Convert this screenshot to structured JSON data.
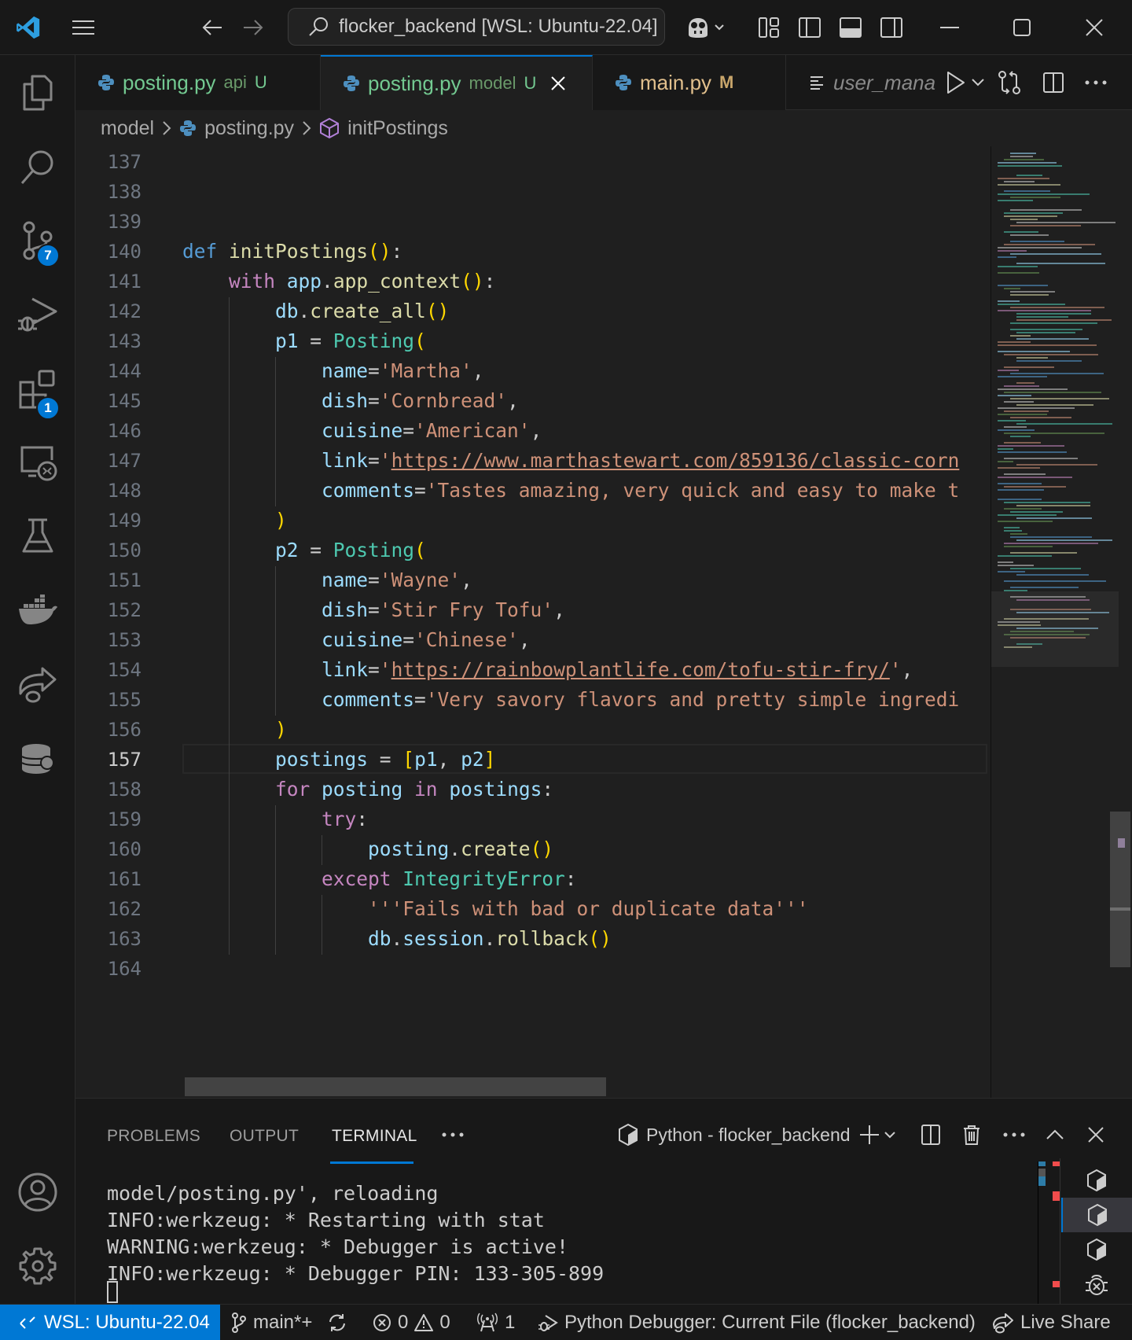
{
  "titlebar": {
    "command_center": "flocker_backend [WSL: Ubuntu-22.04]"
  },
  "activitybar": {
    "items": [
      {
        "name": "explorer",
        "icon": "files-icon"
      },
      {
        "name": "search",
        "icon": "search-icon"
      },
      {
        "name": "source-control",
        "icon": "source-control-icon",
        "badge": "7"
      },
      {
        "name": "run-debug",
        "icon": "run-debug-icon"
      },
      {
        "name": "extensions",
        "icon": "extensions-icon",
        "badge": "1"
      },
      {
        "name": "remote-explorer",
        "icon": "remote-explorer-icon"
      },
      {
        "name": "testing",
        "icon": "flask-icon"
      },
      {
        "name": "docker",
        "icon": "docker-icon"
      },
      {
        "name": "live-share",
        "icon": "live-share-icon"
      },
      {
        "name": "sqlalchemy",
        "icon": "sqla-icon"
      }
    ],
    "bottom": [
      {
        "name": "accounts",
        "icon": "account-icon"
      },
      {
        "name": "manage",
        "icon": "gear-icon"
      }
    ]
  },
  "tabs": [
    {
      "label": "posting.py",
      "desc": "api",
      "status": "U",
      "color": "#73c991",
      "active": false
    },
    {
      "label": "posting.py",
      "desc": "model",
      "status": "U",
      "color": "#73c991",
      "active": true
    },
    {
      "label": "main.py",
      "desc": "",
      "status": "M",
      "color": "#e2c08d",
      "active": false
    }
  ],
  "tab_actions": {
    "outline_label": "user_mana"
  },
  "breadcrumb": [
    "model",
    "posting.py",
    "initPostings"
  ],
  "editor": {
    "current_line": 157,
    "lines": [
      {
        "n": "137",
        "tokens": []
      },
      {
        "n": "138",
        "tokens": []
      },
      {
        "n": "139",
        "tokens": []
      },
      {
        "n": "140",
        "tokens": [
          [
            "kw",
            "def "
          ],
          [
            "fn",
            "initPostings"
          ],
          [
            "br",
            "()"
          ],
          [
            "",
            ":"
          ]
        ]
      },
      {
        "n": "141",
        "tokens": [
          [
            "",
            "    "
          ],
          [
            "ctl",
            "with "
          ],
          [
            "var",
            "app"
          ],
          [
            "",
            "."
          ],
          [
            "fn",
            "app_context"
          ],
          [
            "br",
            "()"
          ],
          [
            "",
            ":"
          ]
        ]
      },
      {
        "n": "142",
        "tokens": [
          [
            "",
            "        "
          ],
          [
            "var",
            "db"
          ],
          [
            "",
            "."
          ],
          [
            "fn",
            "create_all"
          ],
          [
            "br",
            "()"
          ]
        ]
      },
      {
        "n": "143",
        "tokens": [
          [
            "",
            "        "
          ],
          [
            "var",
            "p1"
          ],
          [
            "",
            " = "
          ],
          [
            "cls",
            "Posting"
          ],
          [
            "br",
            "("
          ]
        ]
      },
      {
        "n": "144",
        "tokens": [
          [
            "",
            "            "
          ],
          [
            "var",
            "name"
          ],
          [
            "",
            "="
          ],
          [
            "str",
            "'Martha'"
          ],
          [
            "",
            ","
          ]
        ]
      },
      {
        "n": "145",
        "tokens": [
          [
            "",
            "            "
          ],
          [
            "var",
            "dish"
          ],
          [
            "",
            "="
          ],
          [
            "str",
            "'Cornbread'"
          ],
          [
            "",
            ","
          ]
        ]
      },
      {
        "n": "146",
        "tokens": [
          [
            "",
            "            "
          ],
          [
            "var",
            "cuisine"
          ],
          [
            "",
            "="
          ],
          [
            "str",
            "'American'"
          ],
          [
            "",
            ","
          ]
        ]
      },
      {
        "n": "147",
        "tokens": [
          [
            "",
            "            "
          ],
          [
            "var",
            "link"
          ],
          [
            "",
            "="
          ],
          [
            "str",
            "'"
          ],
          [
            "url",
            "https://www.marthastewart.com/859136/classic-corn"
          ]
        ]
      },
      {
        "n": "148",
        "tokens": [
          [
            "",
            "            "
          ],
          [
            "var",
            "comments"
          ],
          [
            "",
            "="
          ],
          [
            "str",
            "'Tastes amazing, very quick and easy to make t"
          ]
        ]
      },
      {
        "n": "149",
        "tokens": [
          [
            "",
            "        "
          ],
          [
            "br",
            ")"
          ]
        ]
      },
      {
        "n": "150",
        "tokens": [
          [
            "",
            "        "
          ],
          [
            "var",
            "p2"
          ],
          [
            "",
            " = "
          ],
          [
            "cls",
            "Posting"
          ],
          [
            "br",
            "("
          ]
        ]
      },
      {
        "n": "151",
        "tokens": [
          [
            "",
            "            "
          ],
          [
            "var",
            "name"
          ],
          [
            "",
            "="
          ],
          [
            "str",
            "'Wayne'"
          ],
          [
            "",
            ","
          ]
        ]
      },
      {
        "n": "152",
        "tokens": [
          [
            "",
            "            "
          ],
          [
            "var",
            "dish"
          ],
          [
            "",
            "="
          ],
          [
            "str",
            "'Stir Fry Tofu'"
          ],
          [
            "",
            ","
          ]
        ]
      },
      {
        "n": "153",
        "tokens": [
          [
            "",
            "            "
          ],
          [
            "var",
            "cuisine"
          ],
          [
            "",
            "="
          ],
          [
            "str",
            "'Chinese'"
          ],
          [
            "",
            ","
          ]
        ]
      },
      {
        "n": "154",
        "tokens": [
          [
            "",
            "            "
          ],
          [
            "var",
            "link"
          ],
          [
            "",
            "="
          ],
          [
            "str",
            "'"
          ],
          [
            "url",
            "https://rainbowplantlife.com/tofu-stir-fry/"
          ],
          [
            "str",
            "'"
          ],
          [
            "",
            ","
          ]
        ]
      },
      {
        "n": "155",
        "tokens": [
          [
            "",
            "            "
          ],
          [
            "var",
            "comments"
          ],
          [
            "",
            "="
          ],
          [
            "str",
            "'Very savory flavors and pretty simple ingredi"
          ]
        ]
      },
      {
        "n": "156",
        "tokens": [
          [
            "",
            "        "
          ],
          [
            "br",
            ")"
          ]
        ]
      },
      {
        "n": "157",
        "tokens": [
          [
            "",
            "        "
          ],
          [
            "var",
            "postings"
          ],
          [
            "",
            " = "
          ],
          [
            "br",
            "["
          ],
          [
            "var",
            "p1"
          ],
          [
            "",
            ", "
          ],
          [
            "var",
            "p2"
          ],
          [
            "br",
            "]"
          ]
        ]
      },
      {
        "n": "158",
        "tokens": [
          [
            "",
            "        "
          ],
          [
            "ctl",
            "for "
          ],
          [
            "var",
            "posting"
          ],
          [
            "ctl",
            " in "
          ],
          [
            "var",
            "postings"
          ],
          [
            "",
            ":"
          ]
        ]
      },
      {
        "n": "159",
        "tokens": [
          [
            "",
            "            "
          ],
          [
            "ctl",
            "try"
          ],
          [
            "",
            ":"
          ]
        ]
      },
      {
        "n": "160",
        "tokens": [
          [
            "",
            "                "
          ],
          [
            "var",
            "posting"
          ],
          [
            "",
            "."
          ],
          [
            "fn",
            "create"
          ],
          [
            "br",
            "()"
          ]
        ]
      },
      {
        "n": "161",
        "tokens": [
          [
            "",
            "            "
          ],
          [
            "ctl",
            "except "
          ],
          [
            "cls",
            "IntegrityError"
          ],
          [
            "",
            ":"
          ]
        ]
      },
      {
        "n": "162",
        "tokens": [
          [
            "",
            "                "
          ],
          [
            "str",
            "'''Fails with bad or duplicate data'''"
          ]
        ]
      },
      {
        "n": "163",
        "tokens": [
          [
            "",
            "                "
          ],
          [
            "var",
            "db"
          ],
          [
            "",
            "."
          ],
          [
            "var",
            "session"
          ],
          [
            "",
            "."
          ],
          [
            "fn",
            "rollback"
          ],
          [
            "br",
            "()"
          ]
        ]
      },
      {
        "n": "164",
        "tokens": []
      }
    ]
  },
  "panel": {
    "tabs": [
      "PROBLEMS",
      "OUTPUT",
      "TERMINAL"
    ],
    "active_tab": "TERMINAL",
    "terminal_name": "Python - flocker_backend",
    "terminal_lines": [
      "model/posting.py', reloading",
      "INFO:werkzeug: * Restarting with stat",
      "WARNING:werkzeug: * Debugger is active!",
      "INFO:werkzeug: * Debugger PIN: 133-305-899"
    ]
  },
  "statusbar": {
    "remote": "WSL: Ubuntu-22.04",
    "branch": "main*+",
    "errors": "0",
    "warnings": "0",
    "ports": "1",
    "debug_config": "Python Debugger: Current File (flocker_backend)",
    "live_share": "Live Share"
  },
  "colors": {
    "accent": "#0078d4",
    "untracked": "#73c991",
    "modified": "#e2c08d"
  }
}
